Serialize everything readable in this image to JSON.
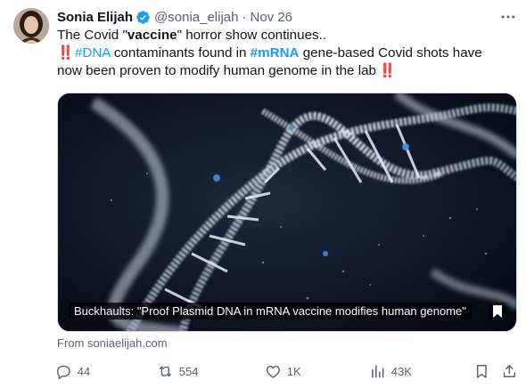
{
  "tweet": {
    "author": {
      "display_name": "Sonia Elijah",
      "handle": "@sonia_elijah",
      "verified": true,
      "avatar_icon": "avatar-photo"
    },
    "separator": "·",
    "date": "Nov 26",
    "more_icon": "more-horizontal-icon",
    "text": {
      "line1_prefix": "The Covid \"",
      "line1_bold": "vaccine",
      "line1_suffix": "\" horror show continues..",
      "emoji": "‼️",
      "line2_hashtag1": "#DNA",
      "line2_mid": " contaminants found in ",
      "line2_hashtag2": "#mRNA",
      "line2_suffix": " gene-based Covid shots have",
      "line3": "now been proven to modify human genome in the lab"
    },
    "media": {
      "caption": "Buckhaults: \"Proof Plasmid DNA in mRNA vaccine modifies human genome\"",
      "bookmark_icon": "bookmark-icon"
    },
    "source": "From soniaelijah.com",
    "actions": {
      "replies": "44",
      "retweets": "554",
      "likes": "1K",
      "views": "43K"
    },
    "colors": {
      "accent": "#1d9bf0",
      "secondary_text": "#536471",
      "text": "#0f1419",
      "bang": "#f91880"
    }
  }
}
